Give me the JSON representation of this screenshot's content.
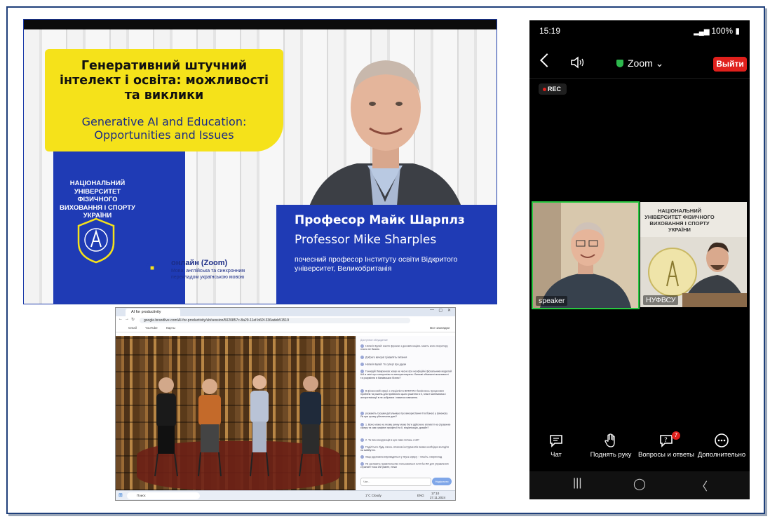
{
  "banner": {
    "title_uk": "Генеративний штучний інтелект і освіта: можливості та виклики",
    "title_en": "Generative AI and Education: Opportunities and Issues",
    "university": "НАЦІОНАЛЬНИЙ УНІВЕРСИТЕТ ФІЗИЧНОГО ВИХОВАННЯ І СПОРТУ УКРАЇНИ",
    "online_title": "онлайн (Zoom)",
    "online_sub": "Мова: англійська та синхронним перекладом українською мовою",
    "prof_name_uk": "Професор Майк Шарплз",
    "prof_name_en": "Professor Mike Sharples",
    "prof_desc": "почесний професор Інституту освіти Відкритого університет, Великобританія"
  },
  "browser": {
    "tab_title": "AI for productivity",
    "url": "google.brandlive.com/AI-for-productivity/ub/session/5020857c-8a29-11ef-b60f-336adeb51519",
    "bookmarks": [
      "Gmail",
      "YouTube",
      "Карты"
    ],
    "bookmarks_right": "Все закладки",
    "chat_header": "Доступное обсуждение",
    "chat_messages": [
      "Наталія Бугай: вжито фразою з декомпозицією, мають коли оператору нічого не бачить",
      "Доброго вечора! Цікавлять питання",
      "Наталія Бугай: То супер! про друзи",
      "Геннадій Левкренков: кому не чесно про неофіційні фіскальники моделей Ш4 в світі про синхронізм та використовують: банкові обмежені можливості та розуміння в банківських бізнес?",
      "В фінансовій сфері з спеціаліста ВИКАТАС банків весь процесових проблем та рішень для прибалого цього рішення в ІІ, пласт математика і алгоритмізації в не-зобраних і навичок навчання.",
      "розкажіть трошки детальніше про використання ІІ в бізнесі у фінансах. Як при цьому убезпечити дані?",
      "1. Воно може на якому ринку може бути здійснено впливі ІІ на справжню сферу та сам графічні професії та ІІ, візуалізація, дизайн?",
      "2. Та яка конкуренція в цих само питань з ШІ?",
      "Поділіться, будь ласка, списком інструментів якими необхідно володіти на майбутнє.",
      "якщо державна впровадиться у якусь сферу – пишіть, наприклад",
      "Як заставить правительство пользоваться хотя бы ИИ для управления страной? пока ИИ умнее, нежи"
    ],
    "chat_placeholder": "Чат...",
    "send_label": "Надіслати",
    "taskbar_search": "Поиск",
    "weather": "1°C Cloudy",
    "lang": "ENG",
    "time": "17:10",
    "date": "27.11.2024"
  },
  "phone": {
    "time": "15:19",
    "battery": "100%",
    "app": "Zoom",
    "leave_label": "Выйти",
    "rec_label": "REC",
    "tiles": [
      {
        "label": "speaker"
      },
      {
        "label": "НУФВСУ"
      }
    ],
    "nufvsu_sign": "НАЦІОНАЛЬНИЙ УНІВЕРСИТЕТ ФІЗИЧНОГО ВИХОВАННЯ І СПОРТУ УКРАЇНИ",
    "controls": [
      {
        "label": "Чат"
      },
      {
        "label": "Поднять руку"
      },
      {
        "label": "Вопросы и ответы",
        "badge": "7"
      },
      {
        "label": "Дополнительно"
      }
    ]
  },
  "colors": {
    "banner_blue": "#1f3bb5",
    "banner_yellow": "#f5e21a",
    "zoom_leave_red": "#e0201c",
    "active_speaker_green": "#28c840"
  }
}
